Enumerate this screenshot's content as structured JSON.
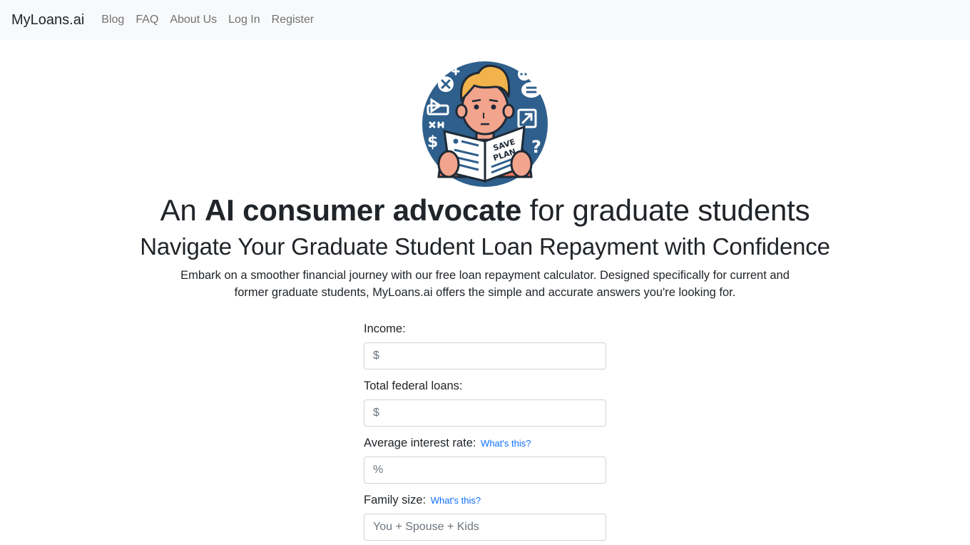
{
  "navbar": {
    "brand": "MyLoans.ai",
    "links": [
      "Blog",
      "FAQ",
      "About Us",
      "Log In",
      "Register"
    ]
  },
  "hero": {
    "logo_alt": "Illustration of a student reading a SAVE PLAN document",
    "logo_doc_text_1": "SAVE",
    "logo_doc_text_2": "PLAN",
    "headline_prefix": "An ",
    "headline_bold": "AI consumer advocate",
    "headline_suffix": " for graduate students",
    "subheadline": "Navigate Your Graduate Student Loan Repayment with Confidence",
    "lead_line_1": "Embark on a smoother financial journey with our free loan repayment calculator. Designed specifically for current and",
    "lead_line_2": "former graduate students, MyLoans.ai offers the simple and accurate answers you're looking for."
  },
  "form": {
    "income": {
      "label": "Income:",
      "placeholder": "$",
      "value": ""
    },
    "loans": {
      "label": "Total federal loans:",
      "placeholder": "$",
      "value": ""
    },
    "interest": {
      "label": "Average interest rate:",
      "help": "What's this?",
      "placeholder": "%",
      "value": ""
    },
    "family": {
      "label": "Family size:",
      "help": "What's this?",
      "placeholder": "You + Spouse + Kids",
      "value": ""
    }
  },
  "colors": {
    "navbar_bg": "#f8f9fa",
    "link": "#0d6efd",
    "logo_circle": "#2f5f8c",
    "hair": "#f2b24c",
    "skin": "#f3a48c",
    "shirt": "#e8735a"
  }
}
